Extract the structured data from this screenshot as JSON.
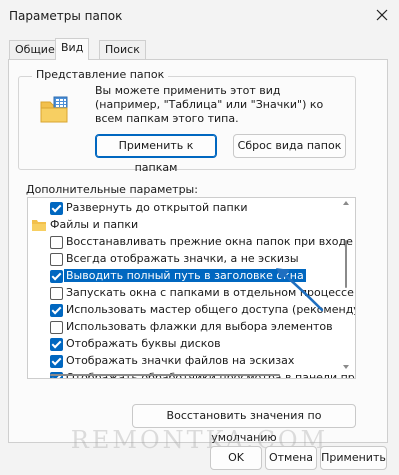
{
  "window": {
    "title": "Параметры папок"
  },
  "tabs": [
    {
      "label": "Общие"
    },
    {
      "label": "Вид"
    },
    {
      "label": "Поиск"
    }
  ],
  "folder_view": {
    "legend": "Представление папок",
    "description": "Вы можете применить этот вид (например, \"Таблица\" или \"Значки\") ко всем папкам этого типа.",
    "apply_button": "Применить к папкам",
    "reset_button": "Сброс вида папок"
  },
  "advanced": {
    "label": "Дополнительные параметры:",
    "items": [
      {
        "text": "Развернуть до открытой папки",
        "checked": true,
        "type": "checkbox"
      },
      {
        "text": "Файлы и папки",
        "type": "folder"
      },
      {
        "text": "Восстанавливать прежние окна папок при входе в с",
        "checked": false,
        "type": "checkbox"
      },
      {
        "text": "Всегда отображать значки, а не эскизы",
        "checked": false,
        "type": "checkbox"
      },
      {
        "text": "Выводить полный путь в заголовке окна",
        "checked": true,
        "type": "checkbox",
        "selected": true
      },
      {
        "text": "Запускать окна с папками в отдельном процессе",
        "checked": false,
        "type": "checkbox"
      },
      {
        "text": "Использовать мастер общего доступа (рекомендует",
        "checked": true,
        "type": "checkbox"
      },
      {
        "text": "Использовать флажки для выбора элементов",
        "checked": false,
        "type": "checkbox"
      },
      {
        "text": "Отображать буквы дисков",
        "checked": true,
        "type": "checkbox"
      },
      {
        "text": "Отображать значки файлов на эскизах",
        "checked": true,
        "type": "checkbox"
      },
      {
        "text": "Отображать обработчики просмотра в панели просм",
        "checked": true,
        "type": "checkbox"
      }
    ],
    "restore_button": "Восстановить значения по умолчанию"
  },
  "footer": {
    "ok_button": "OK",
    "cancel_button": "Отмена",
    "apply_button": "Применить"
  },
  "watermark": "REMONTKA.COM",
  "colors": {
    "accent": "#0067c0",
    "arrow": "#1f6fc0"
  }
}
